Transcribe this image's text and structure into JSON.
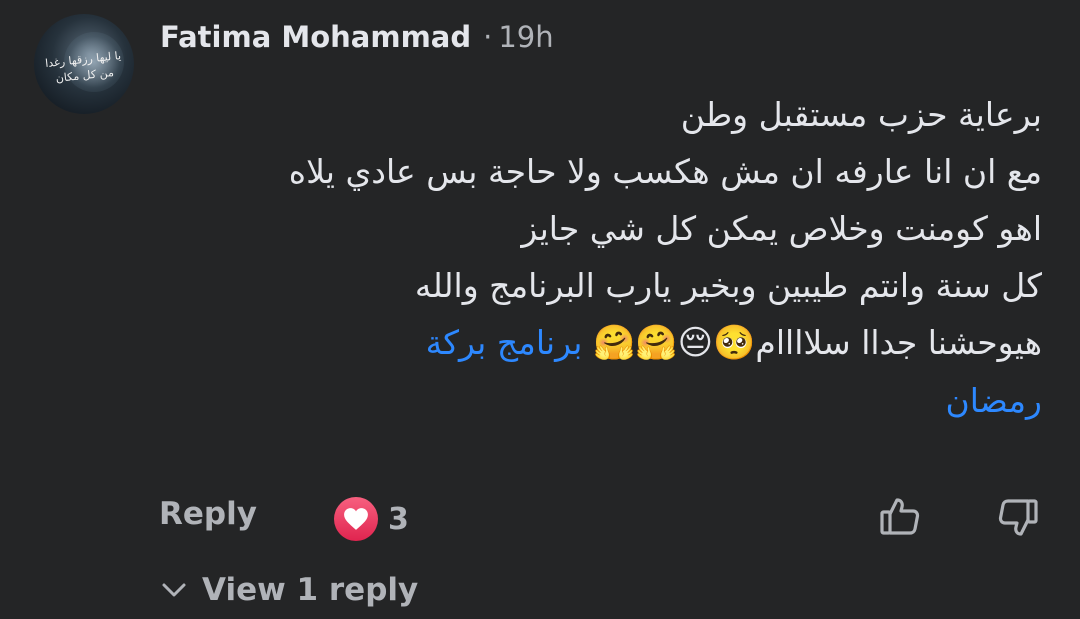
{
  "comment": {
    "author": "Fatima Mohammad",
    "separator": "·",
    "time": "19h",
    "avatar_text_line1": "يا ليها رزقها رغدا",
    "avatar_text_line2": "من كل مكان",
    "lines": [
      "برعاية حزب مستقبل وطن",
      "مع ان انا عارفه ان مش هكسب ولا حاجة بس عادي يلاه",
      "اهو كومنت وخلاص يمكن كل شي جايز",
      "كل سنة وانتم طيبين وبخير يارب البرنامج والله"
    ],
    "last_line_text": "هيوحشنا جداا سلاااام",
    "emojis": "🥺😔🤗🤗",
    "hashtag_part1": "برنامج بركة",
    "hashtag_part2": "رمضان"
  },
  "actions": {
    "reply_label": "Reply",
    "reaction_icon": "heart-icon",
    "reaction_count": "3",
    "like_icon": "thumbs-up-icon",
    "dislike_icon": "thumbs-down-icon"
  },
  "replies": {
    "view_label": "View 1 reply",
    "icon": "chevron-down-icon"
  },
  "colors": {
    "background": "#242526",
    "text": "#e4e6eb",
    "muted": "#b0b3b8",
    "link": "#2d88ff",
    "heart": "#e0244f"
  }
}
